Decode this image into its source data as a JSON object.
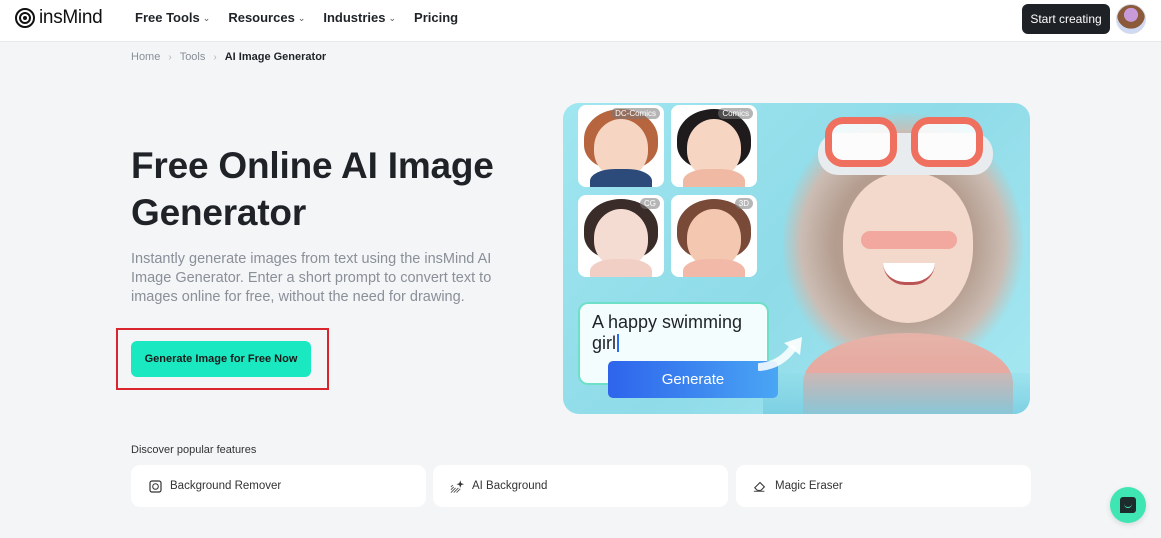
{
  "header": {
    "logo_text": "insMind",
    "nav": [
      {
        "label": "Free Tools",
        "has_dropdown": true
      },
      {
        "label": "Resources",
        "has_dropdown": true
      },
      {
        "label": "Industries",
        "has_dropdown": true
      },
      {
        "label": "Pricing",
        "has_dropdown": false
      }
    ],
    "dropdown_glyph": "⌄",
    "start_label": "Start creating"
  },
  "breadcrumb": {
    "items": [
      "Home",
      "Tools"
    ],
    "current": "AI Image Generator",
    "separator": "›"
  },
  "hero": {
    "title": "Free Online AI Image Generator",
    "description": "Instantly generate images from text using the insMind AI Image Generator. Enter a short prompt to convert text to images online for free, without the need for drawing.",
    "cta_label": "Generate Image for Free Now",
    "highlight_color": "#d9262e",
    "cta_color": "#19e8c0"
  },
  "showcase": {
    "styles": [
      "DC-Comics",
      "Comics",
      "CG",
      "3D"
    ],
    "prompt_text": "A happy swimming girl",
    "generate_label": "Generate"
  },
  "features": {
    "title": "Discover popular features",
    "items": [
      {
        "label": "Background Remover",
        "icon": "background-remover-icon"
      },
      {
        "label": "AI Background",
        "icon": "ai-background-icon"
      },
      {
        "label": "Magic Eraser",
        "icon": "eraser-icon"
      }
    ]
  },
  "chat": {
    "icon": "chat-icon",
    "color": "#3fe6b4"
  }
}
